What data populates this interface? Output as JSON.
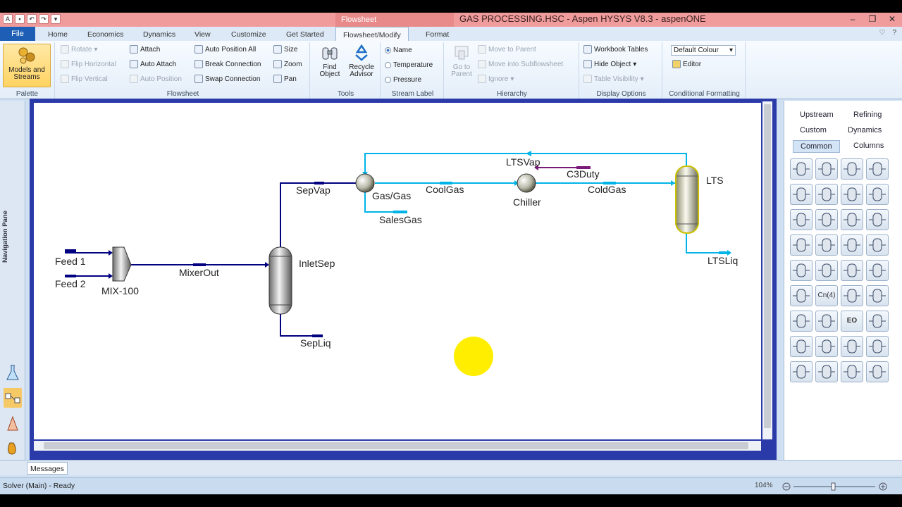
{
  "titlebar": {
    "context_tab": "Flowsheet",
    "title": "GAS PROCESSING.HSC - Aspen HYSYS V8.3 - aspenONE"
  },
  "tabs": {
    "file": "File",
    "items": [
      "Home",
      "Economics",
      "Dynamics",
      "View",
      "Customize",
      "Get Started",
      "Flowsheet/Modify",
      "Format"
    ],
    "active": "Flowsheet/Modify"
  },
  "ribbon": {
    "palette": {
      "button": "Models and Streams",
      "label": "Palette"
    },
    "flowsheet": {
      "label": "Flowsheet",
      "rotate": "Rotate",
      "flip_h": "Flip Horizontal",
      "flip_v": "Flip Vertical",
      "attach": "Attach",
      "auto_attach": "Auto Attach",
      "auto_position": "Auto Position",
      "auto_position_all": "Auto Position All",
      "break_connection": "Break Connection",
      "swap_connection": "Swap Connection",
      "size": "Size",
      "zoom": "Zoom",
      "pan": "Pan"
    },
    "tools": {
      "label": "Tools",
      "find_object": "Find Object",
      "recycle_advisor": "Recycle Advisor"
    },
    "stream_label": {
      "label": "Stream Label",
      "name": "Name",
      "temperature": "Temperature",
      "pressure": "Pressure",
      "selected": "Name"
    },
    "hierarchy": {
      "label": "Hierarchy",
      "go_to_parent": "Go to Parent",
      "move_to_parent": "Move to Parent",
      "move_into_subflowsheet": "Move into Subflowsheet",
      "ignore": "Ignore"
    },
    "display_options": {
      "label": "Display Options",
      "workbook_tables": "Workbook Tables",
      "hide_object": "Hide Object",
      "table_visibility": "Table Visibility"
    },
    "conditional_formatting": {
      "label": "Conditional Formatting",
      "colour_scheme": "Default Colour",
      "editor": "Editor"
    }
  },
  "leftnav": {
    "label": "Navigation Pane"
  },
  "flowsheet": {
    "streams": {
      "feed1": "Feed 1",
      "feed2": "Feed 2",
      "mixerout": "MixerOut",
      "sepvap": "SepVap",
      "sepliq": "SepLiq",
      "coolgas": "CoolGas",
      "salesgas": "SalesGas",
      "coldgas": "ColdGas",
      "ltsvap": "LTSVap",
      "ltsliq": "LTSLiq",
      "c3duty": "C3Duty"
    },
    "units": {
      "mixer": "MIX-100",
      "inletsep": "InletSep",
      "gasgas": "Gas/Gas",
      "chiller": "Chiller",
      "lts": "LTS"
    },
    "colors": {
      "material": "#000080",
      "cold": "#00b4e8",
      "energy": "#7a1a78"
    }
  },
  "palette": {
    "tabs": [
      "Upstream",
      "Refining",
      "Custom",
      "Dynamics",
      "Common",
      "Columns"
    ],
    "active": "Common",
    "icons": [
      "separator-icon",
      "three-phase-sep-icon",
      "tank-icon",
      "compressor-icon",
      "pump-icon",
      "heat-exchanger-icon",
      "cooler-icon",
      "valve-icon",
      "fired-heater-icon",
      "expander-icon",
      "reactor-icon",
      "plug-flow-icon",
      "cstr-icon",
      "heater-icon",
      "tee-icon",
      "mixer-icon",
      "component-splitter-icon",
      "distillation-icon",
      "absorber-icon",
      "lng-icon",
      "pipe-segment-icon",
      "component-count-icon",
      "recycle-icon",
      "spreadsheet-icon",
      "balance-icon",
      "subflowsheet-icon",
      "eo-icon",
      "column-icon",
      "reboiled-absorber-icon",
      "refluxed-absorber-icon",
      "relief-valve-icon",
      "three-stage-icon",
      "filter-icon",
      "ph-adjust-icon",
      "crusher-icon",
      "cyclone-icon"
    ],
    "icon_texts": {
      "component_count": "Cn(4)",
      "eo": "EO"
    }
  },
  "messages": {
    "tab": "Messages"
  },
  "status": {
    "solver": "Solver (Main) - Ready",
    "zoom": "104%"
  }
}
